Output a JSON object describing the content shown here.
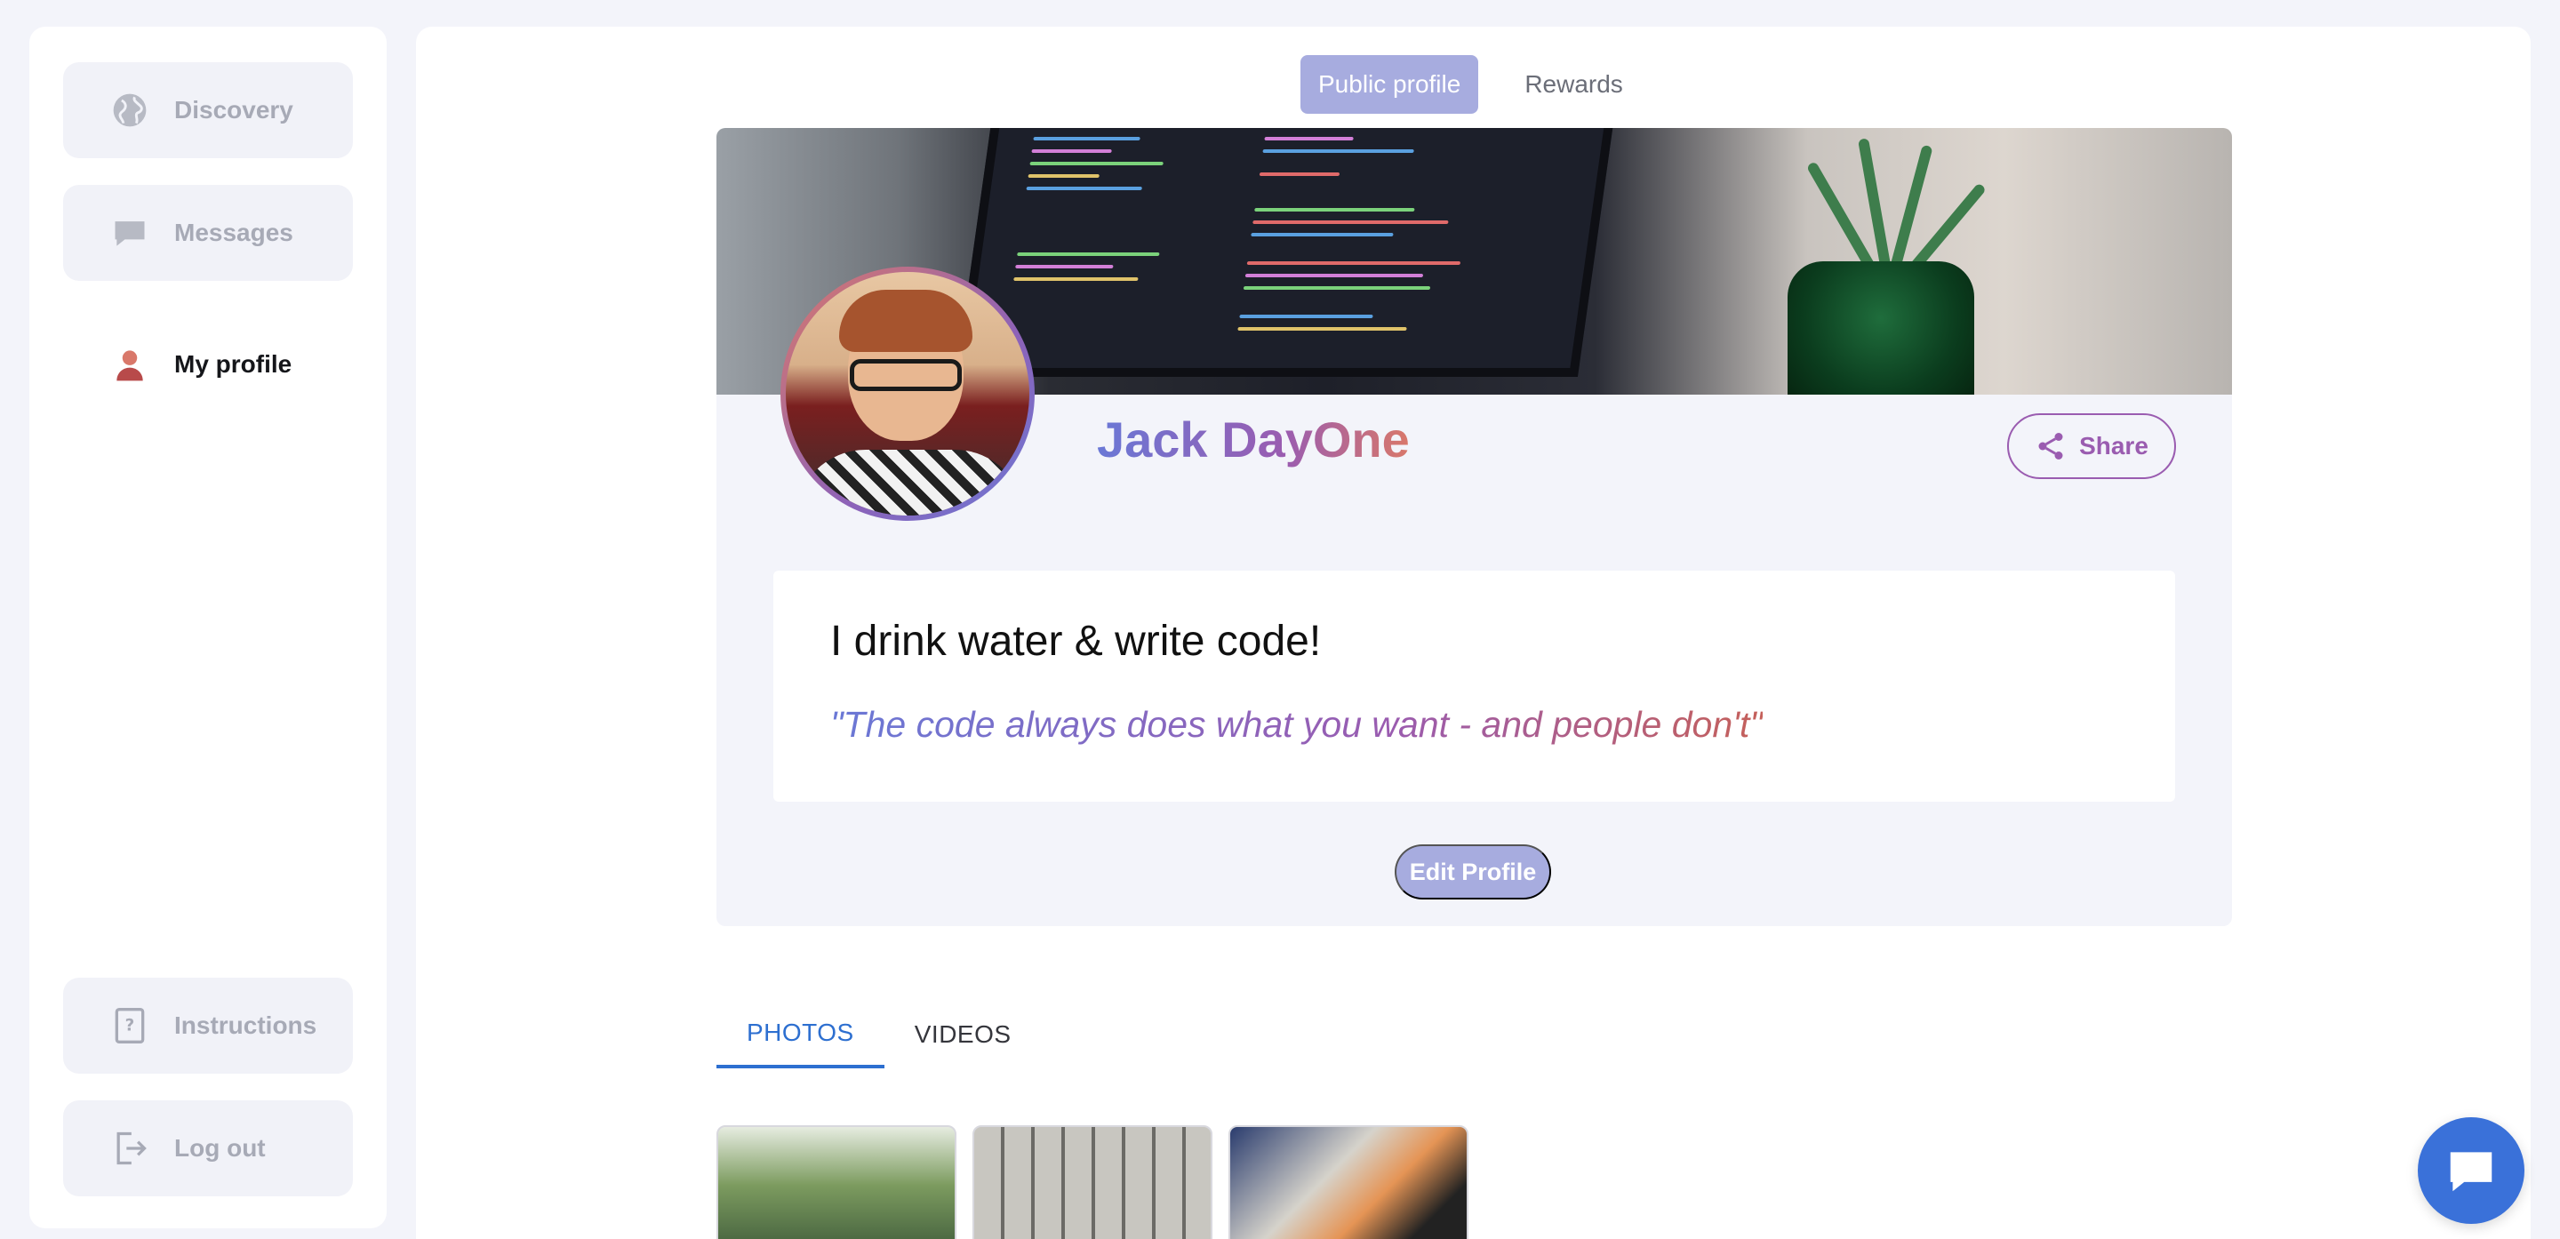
{
  "sidebar": {
    "items": [
      {
        "label": "Discovery",
        "icon": "globe-icon"
      },
      {
        "label": "Messages",
        "icon": "chat-icon"
      },
      {
        "label": "My profile",
        "icon": "user-icon"
      }
    ],
    "bottom_items": [
      {
        "label": "Instructions",
        "icon": "help-book-icon"
      },
      {
        "label": "Log out",
        "icon": "logout-icon"
      }
    ]
  },
  "top_tabs": [
    {
      "label": "Public profile",
      "active": true
    },
    {
      "label": "Rewards",
      "active": false
    }
  ],
  "profile": {
    "name": "Jack DayOne",
    "share_label": "Share",
    "bio": "I drink water & write code!",
    "quote": "\"The code always does what you want - and people don't\"",
    "edit_label": "Edit Profile"
  },
  "media_tabs": [
    {
      "label": "PHOTOS",
      "active": true
    },
    {
      "label": "VIDEOS",
      "active": false
    }
  ],
  "colors": {
    "accent": "#a7acdf",
    "tab_active": "#2d6fd0",
    "gradient_start": "#6a78d6",
    "gradient_end": "#d9786a",
    "chat_fab": "#3a71d9"
  }
}
